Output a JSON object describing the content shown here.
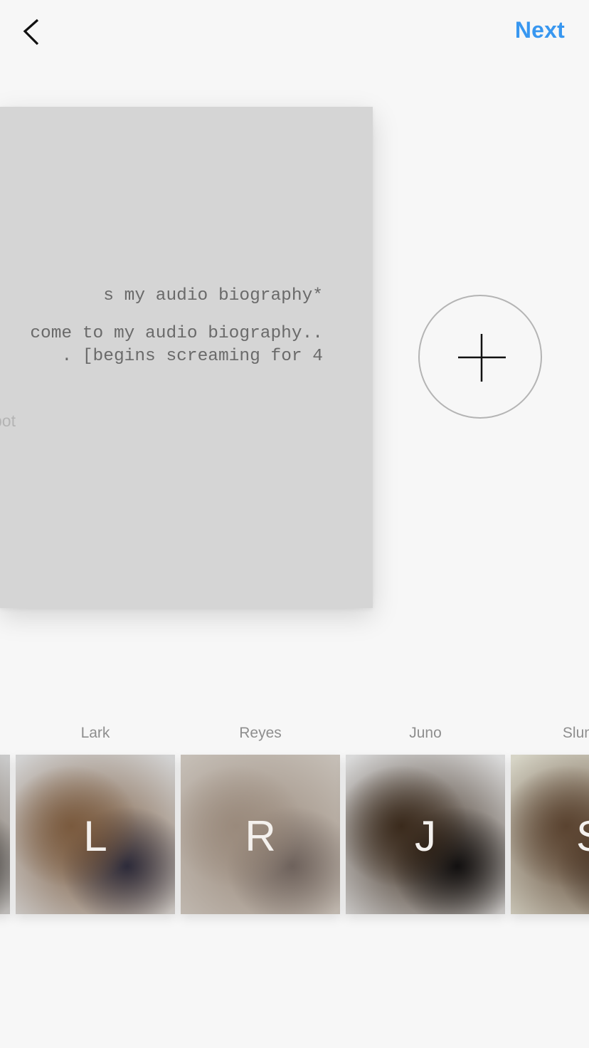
{
  "header": {
    "back_icon": "chevron-left-icon",
    "next_label": "Next",
    "accent_color": "#3897f0"
  },
  "card": {
    "lines": [
      "s my audio biography*",
      "come to my audio biography..",
      ". [begins screaming for 4"
    ],
    "footer": "bot",
    "background": "#d5d5d5"
  },
  "add_button": {
    "icon": "plus-icon"
  },
  "filters": [
    {
      "name": "",
      "letter": "",
      "colors": [
        "#c9c9c9",
        "#6b5a4a",
        "#2a2a2a"
      ]
    },
    {
      "name": "Lark",
      "letter": "L",
      "colors": [
        "#d2d2d2",
        "#7a5a3e",
        "#2d2b3a"
      ]
    },
    {
      "name": "Reyes",
      "letter": "R",
      "colors": [
        "#c5beb6",
        "#9a8a7c",
        "#6e625c"
      ]
    },
    {
      "name": "Juno",
      "letter": "J",
      "colors": [
        "#d9d9d9",
        "#3a2a1c",
        "#121010"
      ]
    },
    {
      "name": "Slumber",
      "letter": "S",
      "colors": [
        "#d6d4c6",
        "#5a4330",
        "#3e2e22"
      ]
    }
  ]
}
